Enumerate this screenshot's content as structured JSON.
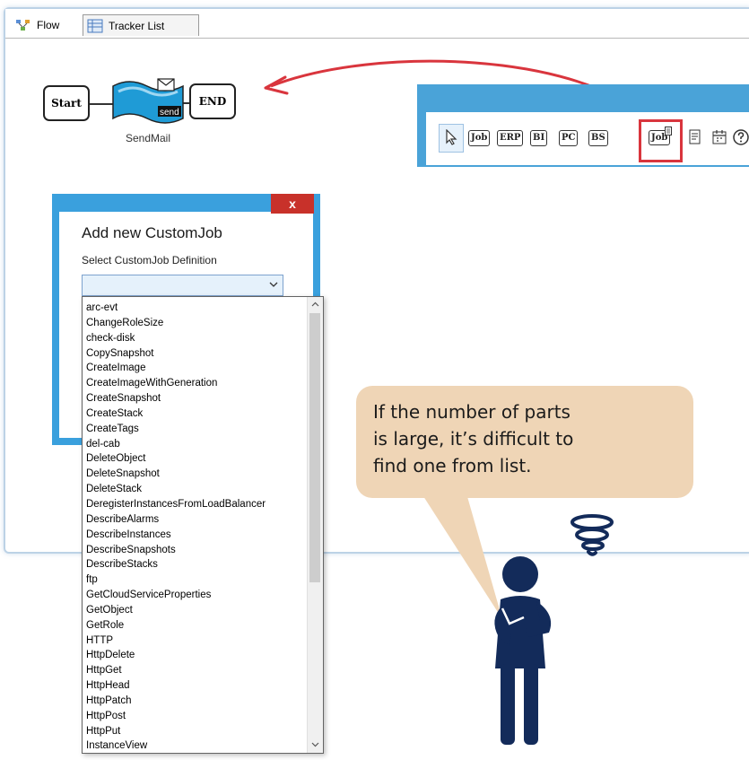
{
  "tabs": [
    {
      "label": "Flow",
      "icon": "flow-icon"
    },
    {
      "label": "Tracker List",
      "icon": "tracker-list-icon"
    }
  ],
  "flow": {
    "start_label": "Start",
    "end_label": "END",
    "job_label": "SendMail",
    "job_icon_text": "send"
  },
  "toolbar": {
    "buttons": [
      {
        "label": "",
        "icon": "pointer-icon"
      },
      {
        "label": "Job"
      },
      {
        "label": "ERP"
      },
      {
        "label": "BI"
      },
      {
        "label": "PC"
      },
      {
        "label": "BS"
      },
      {
        "label": "Job",
        "icon": "custom-job-icon"
      },
      {
        "label": "",
        "icon": "document-icon"
      },
      {
        "label": "",
        "icon": "calendar-icon"
      },
      {
        "label": "",
        "icon": "help-icon"
      }
    ],
    "highlight_color": "#d9353d",
    "frame_color": "#4aa3d8"
  },
  "dialog": {
    "title": "Add new CustomJob",
    "close_glyph": "x",
    "select_label": "Select CustomJob Definition",
    "select_value": "",
    "options": [
      "arc-evt",
      "ChangeRoleSize",
      "check-disk",
      "CopySnapshot",
      "CreateImage",
      "CreateImageWithGeneration",
      "CreateSnapshot",
      "CreateStack",
      "CreateTags",
      "del-cab",
      "DeleteObject",
      "DeleteSnapshot",
      "DeleteStack",
      "DeregisterInstancesFromLoadBalancer",
      "DescribeAlarms",
      "DescribeInstances",
      "DescribeSnapshots",
      "DescribeStacks",
      "ftp",
      "GetCloudServiceProperties",
      "GetObject",
      "GetRole",
      "HTTP",
      "HttpDelete",
      "HttpGet",
      "HttpHead",
      "HttpPatch",
      "HttpPost",
      "HttpPut",
      "InstanceView"
    ]
  },
  "callout": {
    "text_lines": [
      "If the number of parts",
      "is large, it’s difficult to",
      "find one from list."
    ],
    "bubble_color": "#efd5b6",
    "figure_color": "#132b5a"
  }
}
